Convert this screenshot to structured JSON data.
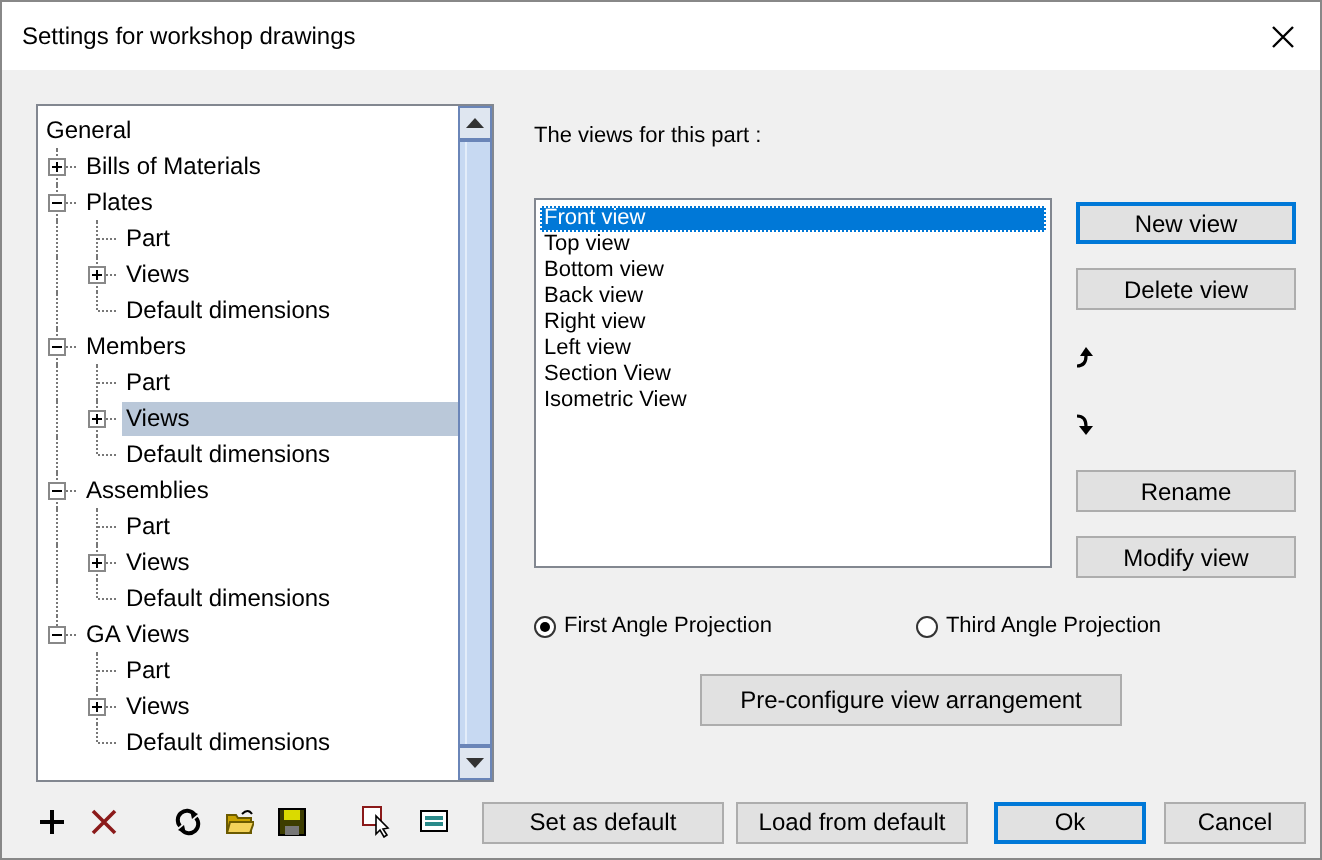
{
  "window": {
    "title": "Settings for workshop drawings"
  },
  "tree": [
    {
      "label": "General",
      "selected": false
    },
    {
      "label": "Bills of Materials",
      "expanded": false,
      "selected": false
    },
    {
      "label": "Plates",
      "expanded": true,
      "selected": false,
      "children": [
        {
          "label": "Part",
          "selected": false
        },
        {
          "label": "Views",
          "expanded": false,
          "selected": false
        },
        {
          "label": "Default dimensions",
          "selected": false
        }
      ]
    },
    {
      "label": "Members",
      "expanded": true,
      "selected": false,
      "children": [
        {
          "label": "Part",
          "selected": false
        },
        {
          "label": "Views",
          "expanded": false,
          "selected": true
        },
        {
          "label": "Default dimensions",
          "selected": false
        }
      ]
    },
    {
      "label": "Assemblies",
      "expanded": true,
      "selected": false,
      "children": [
        {
          "label": "Part",
          "selected": false
        },
        {
          "label": "Views",
          "expanded": false,
          "selected": false
        },
        {
          "label": "Default dimensions",
          "selected": false
        }
      ]
    },
    {
      "label": "GA Views",
      "expanded": true,
      "selected": false,
      "children": [
        {
          "label": "Part",
          "selected": false
        },
        {
          "label": "Views",
          "expanded": false,
          "selected": false
        },
        {
          "label": "Default dimensions",
          "selected": false
        }
      ]
    }
  ],
  "views_label": "The views for this part :",
  "views": [
    {
      "label": "Front view",
      "selected": true
    },
    {
      "label": "Top view",
      "selected": false
    },
    {
      "label": "Bottom view",
      "selected": false
    },
    {
      "label": "Back view",
      "selected": false
    },
    {
      "label": "Right view",
      "selected": false
    },
    {
      "label": "Left view",
      "selected": false
    },
    {
      "label": "Section View",
      "selected": false
    },
    {
      "label": "Isometric View",
      "selected": false
    }
  ],
  "view_buttons": [
    {
      "kind": "button",
      "label": "New view",
      "default": true
    },
    {
      "kind": "button",
      "label": "Delete view",
      "default": false
    },
    {
      "kind": "move-up"
    },
    {
      "kind": "move-down"
    },
    {
      "kind": "button",
      "label": "Rename",
      "default": false
    },
    {
      "kind": "button",
      "label": "Modify view",
      "default": false
    }
  ],
  "projection": [
    {
      "label": "First Angle Projection",
      "selected": true
    },
    {
      "label": "Third Angle Projection",
      "selected": false
    }
  ],
  "preconfigure": "Pre-configure view arrangement",
  "toolbar": [
    {
      "kind": "add"
    },
    {
      "kind": "delete"
    },
    {
      "kind": "refresh"
    },
    {
      "kind": "open"
    },
    {
      "kind": "save"
    },
    {
      "kind": "select"
    },
    {
      "kind": "window"
    }
  ],
  "footer_buttons": [
    {
      "label": "Set as default",
      "default": false
    },
    {
      "label": "Load from default",
      "default": false
    },
    {
      "label": "Ok",
      "default": true
    },
    {
      "label": "Cancel",
      "default": false
    }
  ]
}
